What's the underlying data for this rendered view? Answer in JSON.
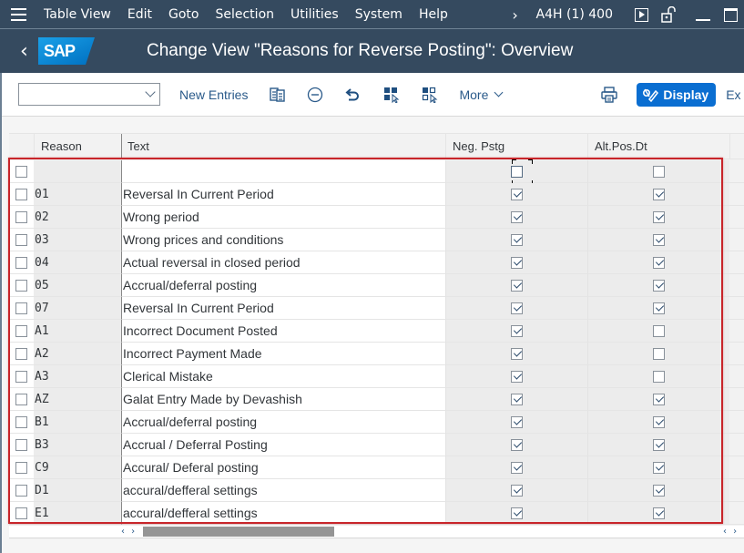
{
  "menubar": {
    "items": [
      {
        "label": "Table View"
      },
      {
        "label": "Edit"
      },
      {
        "label": "Goto"
      },
      {
        "label": "Selection"
      },
      {
        "label": "Utilities"
      },
      {
        "label": "System"
      },
      {
        "label": "Help"
      }
    ],
    "system_info": "A4H (1) 400",
    "icons": [
      "menu-icon",
      "chevron-right-icon",
      "play-icon",
      "unlock-icon",
      "minimize-icon",
      "maximize-icon"
    ]
  },
  "shellbar": {
    "back_icon": "chevron-left-icon",
    "logo_text": "SAP",
    "title": "Change View \"Reasons for Reverse Posting\": Overview"
  },
  "toolbar": {
    "okcode_value": "",
    "new_entries_label": "New Entries",
    "more_label": "More",
    "display_label": "Display",
    "ex_label": "Ex",
    "icons": [
      "copy-icon",
      "delete-icon",
      "undo-icon",
      "select-all-icon",
      "deselect-all-icon",
      "print-icon",
      "display-change-icon"
    ]
  },
  "table": {
    "columns": [
      {
        "key": "reason",
        "label": "Reason"
      },
      {
        "key": "text",
        "label": "Text"
      },
      {
        "key": "neg_pstg",
        "label": "Neg. Pstg"
      },
      {
        "key": "alt_pos_dt",
        "label": "Alt.Pos.Dt"
      }
    ],
    "rows": [
      {
        "reason": "",
        "text": "",
        "neg_pstg": false,
        "alt_pos_dt": false,
        "focused": true
      },
      {
        "reason": "01",
        "text": "Reversal In Current Period",
        "neg_pstg": true,
        "alt_pos_dt": true
      },
      {
        "reason": "02",
        "text": "Wrong period",
        "neg_pstg": true,
        "alt_pos_dt": true
      },
      {
        "reason": "03",
        "text": "Wrong prices and conditions",
        "neg_pstg": true,
        "alt_pos_dt": true
      },
      {
        "reason": "04",
        "text": "Actual reversal in closed period",
        "neg_pstg": true,
        "alt_pos_dt": true
      },
      {
        "reason": "05",
        "text": "Accrual/deferral posting",
        "neg_pstg": true,
        "alt_pos_dt": true
      },
      {
        "reason": "07",
        "text": "Reversal In Current Period",
        "neg_pstg": true,
        "alt_pos_dt": true
      },
      {
        "reason": "A1",
        "text": "Incorrect Document Posted",
        "neg_pstg": true,
        "alt_pos_dt": false
      },
      {
        "reason": "A2",
        "text": "Incorrect Payment Made",
        "neg_pstg": true,
        "alt_pos_dt": false
      },
      {
        "reason": "A3",
        "text": "Clerical Mistake",
        "neg_pstg": true,
        "alt_pos_dt": false
      },
      {
        "reason": "AZ",
        "text": "Galat Entry Made by Devashish",
        "neg_pstg": true,
        "alt_pos_dt": true
      },
      {
        "reason": "B1",
        "text": "Accrual/deferral posting",
        "neg_pstg": true,
        "alt_pos_dt": true
      },
      {
        "reason": "B3",
        "text": "Accrual / Deferral Posting",
        "neg_pstg": true,
        "alt_pos_dt": true
      },
      {
        "reason": "C9",
        "text": "Accural/ Deferal posting",
        "neg_pstg": true,
        "alt_pos_dt": true
      },
      {
        "reason": "D1",
        "text": "accural/defferal settings",
        "neg_pstg": true,
        "alt_pos_dt": true
      },
      {
        "reason": "E1",
        "text": "accural/defferal settings",
        "neg_pstg": true,
        "alt_pos_dt": true
      }
    ],
    "scroll_arrows": "‹ ›"
  },
  "colors": {
    "shell": "#354a5f",
    "accent": "#0a6ed1",
    "highlight_border": "#c8252a"
  }
}
